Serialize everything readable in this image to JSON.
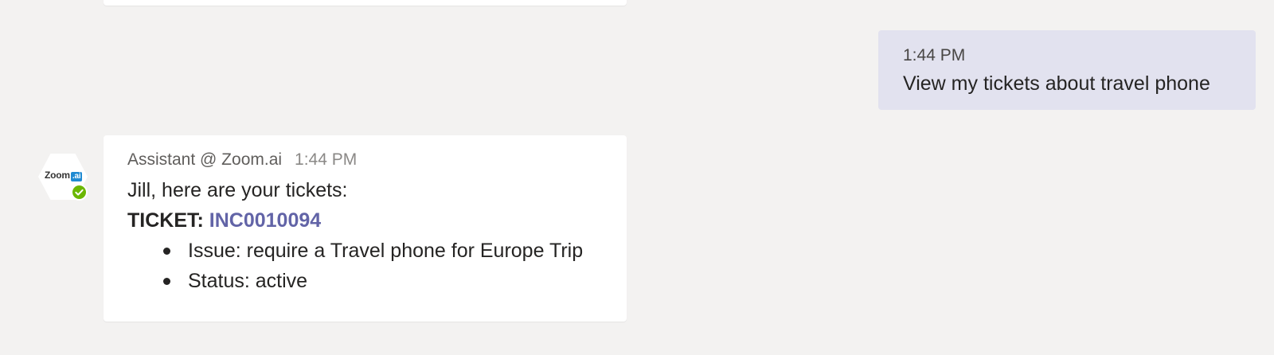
{
  "outgoing_message": {
    "time": "1:44 PM",
    "text": "View my tickets about travel phone"
  },
  "incoming_message": {
    "avatar": {
      "logo_text": "Zoom",
      "logo_badge": ".ai",
      "presence": "available-check-icon"
    },
    "sender": "Assistant @ Zoom.ai",
    "time": "1:44 PM",
    "greeting": "Jill, here are your tickets:",
    "ticket_label": "TICKET:",
    "ticket_id": "INC0010094",
    "details": [
      "Issue: require a Travel phone for Europe Trip",
      "Status: active"
    ]
  },
  "colors": {
    "background": "#f3f2f1",
    "outgoing_bubble": "#e2e2ef",
    "incoming_bubble": "#ffffff",
    "link": "#6264a7",
    "presence": "#6bb700"
  }
}
